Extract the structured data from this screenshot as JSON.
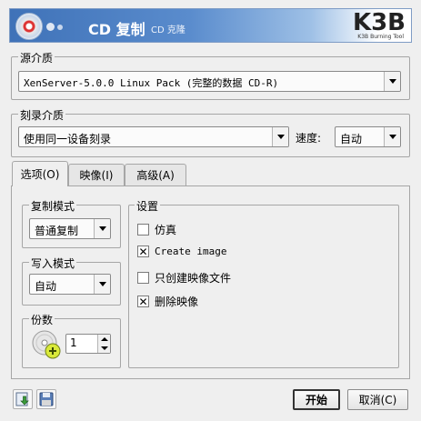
{
  "header": {
    "title": "CD 复制",
    "subtitle": "CD 克隆",
    "logo": "K3B",
    "logo_sub": "K3B Burning Tool"
  },
  "source": {
    "group_title": "源介质",
    "value": "XenServer-5.0.0 Linux Pack (完整的数据 CD-R)"
  },
  "burn": {
    "group_title": "刻录介质",
    "device_value": "使用同一设备刻录",
    "speed_label": "速度:",
    "speed_value": "自动"
  },
  "tabs": [
    {
      "label": "选项(O)",
      "active": true
    },
    {
      "label": "映像(I)",
      "active": false
    },
    {
      "label": "高级(A)",
      "active": false
    }
  ],
  "options": {
    "copy_mode": {
      "title": "复制模式",
      "value": "普通复制"
    },
    "write_mode": {
      "title": "写入模式",
      "value": "自动"
    },
    "copies": {
      "title": "份数",
      "value": "1"
    },
    "settings": {
      "title": "设置",
      "items": [
        {
          "label": "仿真",
          "checked": false
        },
        {
          "label": "Create image",
          "checked": true
        },
        {
          "label": "只创建映像文件",
          "checked": false
        },
        {
          "label": "删除映像",
          "checked": true
        }
      ]
    }
  },
  "footer": {
    "start_label": "开始",
    "cancel_label": "取消(C)"
  },
  "icons": {
    "banner": "cd-icon",
    "copies": "disc-copies-icon",
    "load": "load-settings-icon",
    "save": "save-icon"
  }
}
